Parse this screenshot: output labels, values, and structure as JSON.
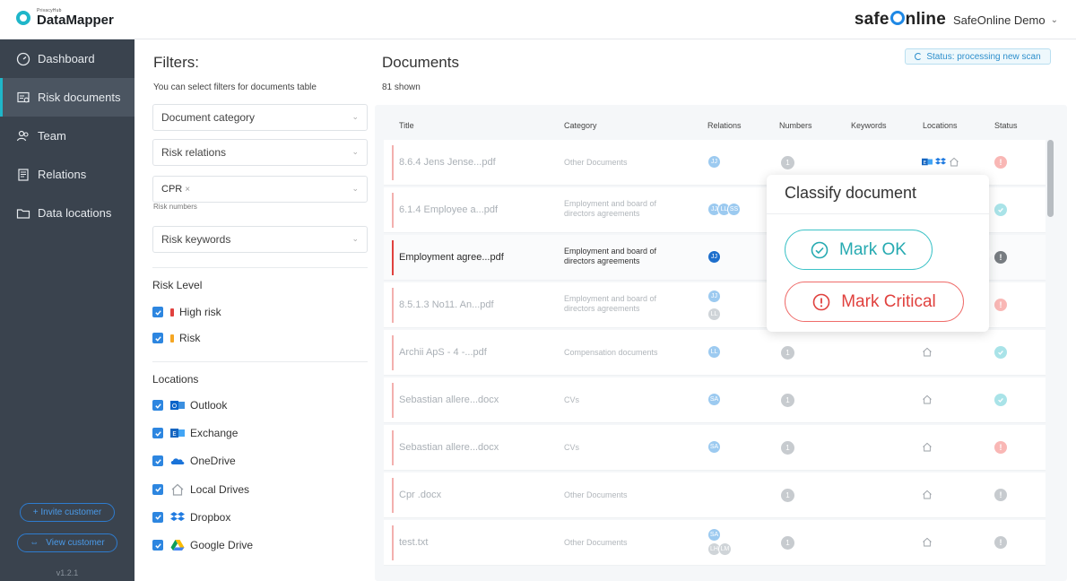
{
  "app": {
    "logo_small": "PrivacyHub",
    "logo_name": "DataMapper",
    "brand_part1": "safe",
    "brand_part2": "nline",
    "account": "SafeOnline Demo",
    "version": "v1.2.1"
  },
  "sidebar": {
    "items": [
      {
        "label": "Dashboard",
        "icon": "gauge-icon"
      },
      {
        "label": "Risk documents",
        "icon": "risk-documents-icon"
      },
      {
        "label": "Team",
        "icon": "team-icon"
      },
      {
        "label": "Relations",
        "icon": "relations-icon"
      },
      {
        "label": "Data locations",
        "icon": "folder-icon"
      }
    ],
    "active_index": 1,
    "invite_label": "+ Invite customer",
    "view_label": "View customer"
  },
  "filters": {
    "title": "Filters:",
    "subtitle": "You can select filters for documents table",
    "document_category": "Document category",
    "risk_relations": "Risk relations",
    "risk_numbers_chip": "CPR",
    "risk_numbers_hint": "Risk numbers",
    "risk_keywords": "Risk keywords",
    "risk_level_title": "Risk Level",
    "risk_levels": [
      {
        "label": "High risk",
        "color": "#e0413e",
        "checked": true
      },
      {
        "label": "Risk",
        "color": "#f5a623",
        "checked": true
      }
    ],
    "locations_title": "Locations",
    "locations": [
      {
        "label": "Outlook",
        "icon": "outlook-icon",
        "checked": true
      },
      {
        "label": "Exchange",
        "icon": "exchange-icon",
        "checked": true
      },
      {
        "label": "OneDrive",
        "icon": "onedrive-icon",
        "checked": true
      },
      {
        "label": "Local Drives",
        "icon": "home-icon",
        "checked": true
      },
      {
        "label": "Dropbox",
        "icon": "dropbox-icon",
        "checked": true
      },
      {
        "label": "Google Drive",
        "icon": "google-drive-icon",
        "checked": true
      }
    ]
  },
  "documents": {
    "title": "Documents",
    "count": "81 shown",
    "status": "Status: processing new scan",
    "columns": [
      "Title",
      "Category",
      "Relations",
      "Numbers",
      "Keywords",
      "Locations",
      "Status"
    ],
    "rows": [
      {
        "title": "8.6.4 Jens Jense...pdf",
        "category": "Other Documents",
        "relations": [
          "JJ"
        ],
        "number": "1",
        "locations": [
          "exchange-icon",
          "dropbox-icon",
          "home-icon"
        ],
        "status": "critical"
      },
      {
        "title": "6.1.4 Employee a...pdf",
        "category": "Employment and board of directors agreements",
        "relations": [
          "JJ",
          "LL",
          "SS"
        ],
        "number": "",
        "locations": [],
        "status": "ok"
      },
      {
        "title": "Employment agree...pdf",
        "category": "Employment and board of directors agreements",
        "relations": [
          "JJ"
        ],
        "number": "",
        "locations": [],
        "status": "unknown",
        "selected": true
      },
      {
        "title": "8.5.1.3 No11. An...pdf",
        "category": "Employment and board of directors agreements",
        "relations": [
          "JJ",
          "LL"
        ],
        "number": "",
        "locations": [],
        "status": "critical"
      },
      {
        "title": "Archii ApS - 4 -...pdf",
        "category": "Compensation documents",
        "relations": [
          "LL"
        ],
        "number": "1",
        "locations": [
          "home-icon"
        ],
        "status": "ok"
      },
      {
        "title": "Sebastian allere...docx",
        "category": "CVs",
        "relations": [
          "SA"
        ],
        "number": "1",
        "locations": [
          "home-icon"
        ],
        "status": "ok"
      },
      {
        "title": "Sebastian allere...docx",
        "category": "CVs",
        "relations": [
          "SA"
        ],
        "number": "1",
        "locations": [
          "home-icon"
        ],
        "status": "critical"
      },
      {
        "title": "Cpr .docx",
        "category": "Other Documents",
        "relations": [],
        "number": "1",
        "locations": [
          "home-icon"
        ],
        "status": "unknown"
      },
      {
        "title": "test.txt",
        "category": "Other Documents",
        "relations": [
          "SA",
          "LH",
          "LM"
        ],
        "number": "1",
        "locations": [
          "home-icon"
        ],
        "status": "unknown"
      }
    ]
  },
  "popover": {
    "title": "Classify document",
    "ok_label": "Mark OK",
    "critical_label": "Mark Critical"
  },
  "colors": {
    "accent": "#1fb6c9",
    "sidebar": "#3a434e",
    "primary": "#2d86e0",
    "critical": "#e0413e",
    "ok": "#3cc2c7"
  }
}
